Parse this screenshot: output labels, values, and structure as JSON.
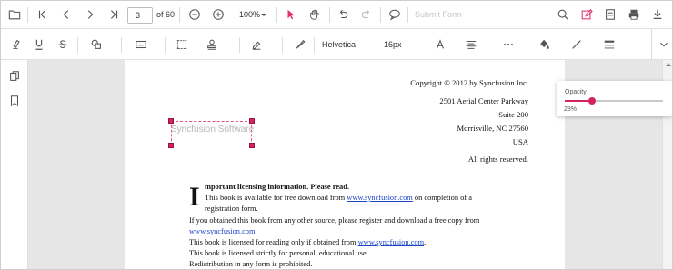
{
  "toolbar": {
    "current_page": "3",
    "page_total": "of 60",
    "zoom": "100%",
    "submit_form": "Submit Form"
  },
  "annotation_toolbar": {
    "font_family": "Helvetica",
    "font_size": "16px"
  },
  "document": {
    "header_lines": [
      "Copyright © 2012 by Syncfusion Inc.",
      "2501 Aerial Center Parkway",
      "Suite 200",
      "Morrisville, NC 27560",
      "USA",
      "All rights reserved."
    ],
    "drop_cap": "I",
    "heading_rest": "mportant licensing information. Please read.",
    "line1_pre": "This book is available for free download from ",
    "line1_link": "www.syncfusion.com",
    "line1_post": " on completion of a",
    "line2": "registration form.",
    "line3": "If you obtained this book from any other source, please register and download a free copy from",
    "line4_link": "www.syncfusion.com",
    "line4_post": ".",
    "line5_pre": "This book is licensed for reading only if obtained from ",
    "line5_link": "www.syncfusion.com",
    "line5_post": ".",
    "line6": "This book is licensed strictly for personal, educational use.",
    "line7": "Redistribution in any form is prohibited."
  },
  "annotation": {
    "text": "Syncfusion Software",
    "border_color": "#e0507d",
    "handle_color": "#d3245f"
  },
  "opacity_popup": {
    "label": "Opacity",
    "value_text": "28%",
    "value": 0.28,
    "accent": "#d3245f"
  },
  "icons": [
    "folder-icon",
    "first-page-icon",
    "previous-page-icon",
    "next-page-icon",
    "last-page-icon",
    "zoom-out-icon",
    "zoom-in-icon",
    "select-pointer-icon",
    "pan-hand-icon",
    "undo-icon",
    "redo-icon",
    "comment-icon",
    "search-icon",
    "annotation-edit-icon",
    "form-designer-icon",
    "print-icon",
    "download-icon",
    "highlight-icon",
    "underline-icon",
    "strikethrough-icon",
    "shapes-icon",
    "calibrate-icon",
    "free-text-icon",
    "stamp-icon",
    "signature-icon",
    "ink-icon",
    "font-color-icon",
    "text-align-icon",
    "more-icon",
    "fill-color-icon",
    "stroke-color-icon",
    "thickness-icon",
    "collapse-icon",
    "thumbnails-icon",
    "bookmark-icon"
  ]
}
